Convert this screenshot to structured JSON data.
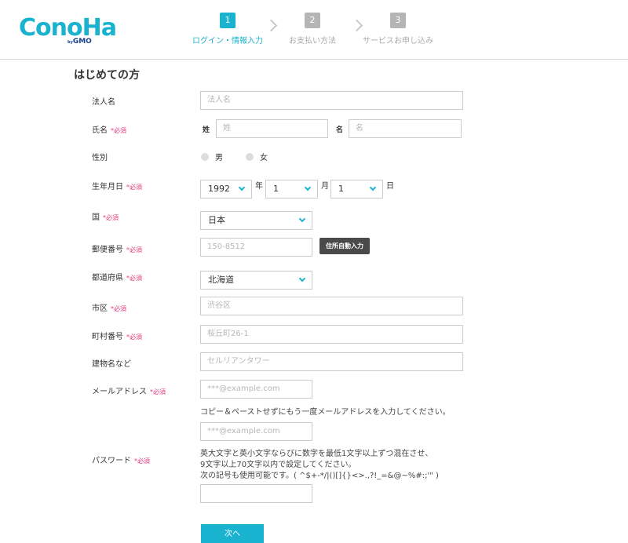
{
  "logo": {
    "text": "ConoHa",
    "by": "by",
    "brand": "GMO"
  },
  "steps": [
    {
      "num": "1",
      "label": "ログイン・情報入力"
    },
    {
      "num": "2",
      "label": "お支払い方法"
    },
    {
      "num": "3",
      "label": "サービスお申し込み"
    }
  ],
  "section_title": "はじめての方",
  "required_mark": "*必須",
  "form": {
    "corp": {
      "label": "法人名",
      "placeholder": "法人名"
    },
    "name": {
      "label": "氏名",
      "sei_label": "姓",
      "sei_placeholder": "姓",
      "mei_label": "名",
      "mei_placeholder": "名"
    },
    "gender": {
      "label": "性別",
      "male": "男",
      "female": "女"
    },
    "birth": {
      "label": "生年月日",
      "year": "1992",
      "year_unit": "年",
      "month": "1",
      "month_unit": "月",
      "day": "1",
      "day_unit": "日"
    },
    "country": {
      "label": "国",
      "value": "日本"
    },
    "postal": {
      "label": "郵便番号",
      "placeholder": "150-8512",
      "button": "住所自動入力"
    },
    "prefecture": {
      "label": "都道府県",
      "value": "北海道"
    },
    "city": {
      "label": "市区",
      "placeholder": "渋谷区"
    },
    "town": {
      "label": "町村番号",
      "placeholder": "桜丘町26-1"
    },
    "building": {
      "label": "建物名など",
      "placeholder": "セルリアンタワー"
    },
    "email": {
      "label": "メールアドレス",
      "placeholder": "***@example.com",
      "confirm_note": "コピー＆ペーストせずにもう一度メールアドレスを入力してください。",
      "confirm_placeholder": "***@example.com"
    },
    "password": {
      "label": "パスワード",
      "note1": "英大文字と英小文字ならびに数字を最低1文字以上ずつ混在させ、",
      "note2": "9文字以上70文字以内で設定してください。",
      "note3": "次の記号も使用可能です。( ^$+-*/|()[]{}<>.,?!_=&@~%#:;'\" )"
    }
  },
  "next_button": "次へ",
  "colors": {
    "accent": "#1ab3cf",
    "required": "#e6377a",
    "dark_button": "#4a4a4a"
  }
}
